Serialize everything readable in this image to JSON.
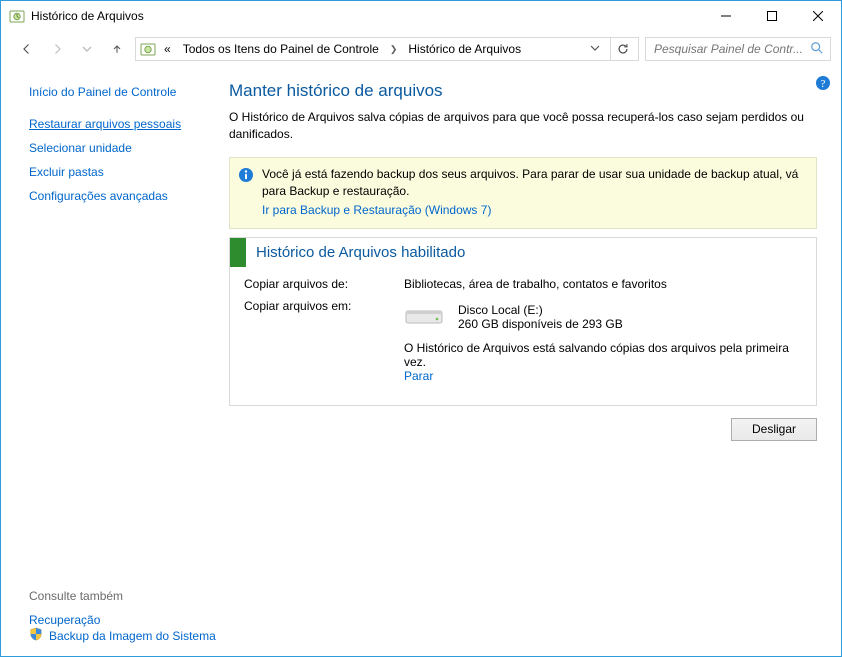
{
  "window": {
    "title": "Histórico de Arquivos"
  },
  "address": {
    "prefix": "«",
    "crumb1": "Todos os Itens do Painel de Controle",
    "crumb2": "Histórico de Arquivos"
  },
  "search": {
    "placeholder": "Pesquisar Painel de Contr..."
  },
  "sidebar": {
    "home": "Início do Painel de Controle",
    "links": [
      "Restaurar arquivos pessoais",
      "Selecionar unidade",
      "Excluir pastas",
      "Configurações avançadas"
    ],
    "see_also_heading": "Consulte também",
    "see_also_items": [
      "Recuperação",
      "Backup da Imagem do Sistema"
    ]
  },
  "main": {
    "heading": "Manter histórico de arquivos",
    "description": "O Histórico de Arquivos salva cópias de arquivos para que você possa recuperá-los caso sejam perdidos ou danificados.",
    "info_banner": {
      "text": "Você já está fazendo backup dos seus arquivos. Para parar de usar sua unidade de backup atual, vá para Backup e restauração.",
      "link": "Ir para Backup e Restauração (Windows 7)"
    },
    "status": {
      "title": "Histórico de Arquivos habilitado",
      "copy_from_label": "Copiar arquivos de:",
      "copy_from_value": "Bibliotecas, área de trabalho, contatos e favoritos",
      "copy_to_label": "Copiar arquivos em:",
      "drive_name": "Disco Local (E:)",
      "drive_space": "260 GB disponíveis de 293 GB",
      "progress_text": "O Histórico de Arquivos está salvando cópias dos arquivos pela primeira vez.",
      "stop_link": "Parar"
    },
    "button": {
      "turn_off": "Desligar"
    }
  }
}
